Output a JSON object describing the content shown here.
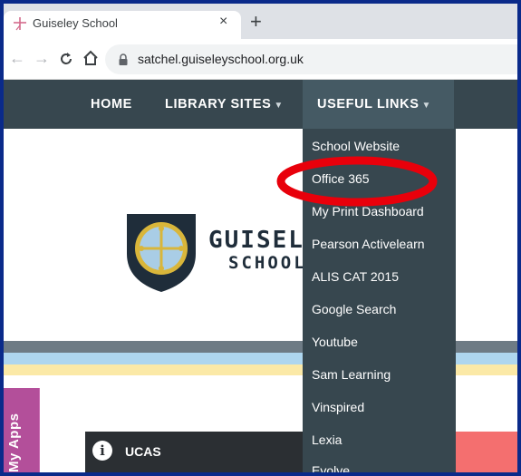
{
  "browser": {
    "tab_title": "Guiseley School",
    "tab_close": "×",
    "new_tab": "+",
    "url": "satchel.guiseleyschool.org.uk"
  },
  "nav": {
    "home": "HOME",
    "library_sites": "LIBRARY SITES",
    "useful_links": "USEFUL LINKS"
  },
  "logo": {
    "name": "GUISELEY",
    "sub": "SCHOOL"
  },
  "dropdown": {
    "items": [
      "School Website",
      "Office 365",
      "My Print Dashboard",
      "Pearson Activelearn",
      "ALIS CAT 2015",
      "Google Search",
      "Youtube",
      "Sam Learning",
      "Vinspired",
      "Lexia",
      "Evolve"
    ]
  },
  "sidebar": {
    "my_apps": "My Apps"
  },
  "cards": {
    "ucas": "UCAS",
    "info_glyph": "i"
  },
  "annotation": {
    "highlight_item": "Office 365",
    "color": "#e8000b"
  },
  "colors": {
    "nav_bg": "#37474f",
    "nav_active_bg": "#455a64",
    "frame_border": "#0a2a8a"
  }
}
